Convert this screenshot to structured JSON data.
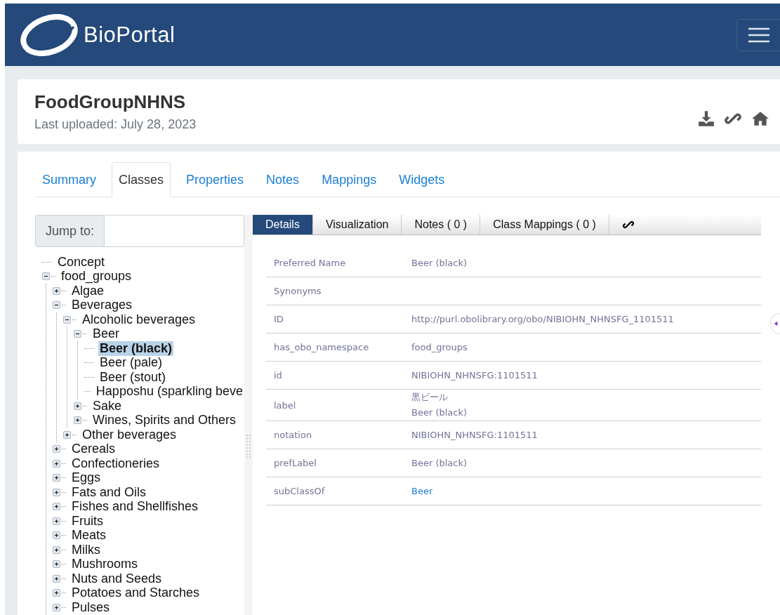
{
  "header": {
    "brand": "BioPortal"
  },
  "ontology": {
    "title": "FoodGroupNHNS",
    "subtitle": "Last uploaded: July 28, 2023"
  },
  "tabs": [
    {
      "label": "Summary",
      "selected": false
    },
    {
      "label": "Classes",
      "selected": true
    },
    {
      "label": "Properties",
      "selected": false
    },
    {
      "label": "Notes",
      "selected": false
    },
    {
      "label": "Mappings",
      "selected": false
    },
    {
      "label": "Widgets",
      "selected": false
    }
  ],
  "jump_to": {
    "label": "Jump to:"
  },
  "tree": [
    {
      "label": "Concept",
      "kind": "leaf",
      "selected": false
    },
    {
      "label": "food_groups",
      "kind": "folder",
      "expanded": true,
      "selected": false,
      "children": [
        {
          "label": "Algae",
          "kind": "folder",
          "expanded": false,
          "selected": false
        },
        {
          "label": "Beverages",
          "kind": "folder",
          "expanded": true,
          "selected": false,
          "children": [
            {
              "label": "Alcoholic beverages",
              "kind": "folder",
              "expanded": true,
              "selected": false,
              "children": [
                {
                  "label": "Beer",
                  "kind": "folder",
                  "expanded": true,
                  "selected": false,
                  "children": [
                    {
                      "label": "Beer (black)",
                      "kind": "leaf",
                      "selected": true
                    },
                    {
                      "label": "Beer (pale)",
                      "kind": "leaf",
                      "selected": false
                    },
                    {
                      "label": "Beer (stout)",
                      "kind": "leaf",
                      "selected": false
                    },
                    {
                      "label": "Happoshu (sparkling beve",
                      "kind": "leaf",
                      "selected": false
                    }
                  ]
                },
                {
                  "label": "Sake",
                  "kind": "folder",
                  "expanded": false,
                  "selected": false
                },
                {
                  "label": "Wines, Spirits and Others",
                  "kind": "folder",
                  "expanded": false,
                  "selected": false
                }
              ]
            },
            {
              "label": "Other beverages",
              "kind": "folder",
              "expanded": false,
              "selected": false
            }
          ]
        },
        {
          "label": "Cereals",
          "kind": "folder",
          "expanded": false,
          "selected": false
        },
        {
          "label": "Confectioneries",
          "kind": "folder",
          "expanded": false,
          "selected": false
        },
        {
          "label": "Eggs",
          "kind": "folder",
          "expanded": false,
          "selected": false
        },
        {
          "label": "Fats and Oils",
          "kind": "folder",
          "expanded": false,
          "selected": false
        },
        {
          "label": "Fishes and Shellfishes",
          "kind": "folder",
          "expanded": false,
          "selected": false
        },
        {
          "label": "Fruits",
          "kind": "folder",
          "expanded": false,
          "selected": false
        },
        {
          "label": "Meats",
          "kind": "folder",
          "expanded": false,
          "selected": false
        },
        {
          "label": "Milks",
          "kind": "folder",
          "expanded": false,
          "selected": false
        },
        {
          "label": "Mushrooms",
          "kind": "folder",
          "expanded": false,
          "selected": false
        },
        {
          "label": "Nuts and Seeds",
          "kind": "folder",
          "expanded": false,
          "selected": false
        },
        {
          "label": "Potatoes and Starches",
          "kind": "folder",
          "expanded": false,
          "selected": false
        },
        {
          "label": "Pulses",
          "kind": "folder",
          "expanded": false,
          "selected": false
        }
      ]
    }
  ],
  "detail_tabs": [
    {
      "label": "Details",
      "selected": true
    },
    {
      "label": "Visualization",
      "selected": false
    },
    {
      "label": "Notes ( 0 )",
      "selected": false
    },
    {
      "label": "Class Mappings ( 0 )",
      "selected": false
    }
  ],
  "details": [
    {
      "name": "Preferred Name",
      "values": [
        {
          "text": "Beer (black)",
          "kind": "text"
        }
      ]
    },
    {
      "name": "Synonyms"
    },
    {
      "name": "ID",
      "values": [
        {
          "text": "http://purl.obolibrary.org/obo/NIBIOHN_NHNSFG_1101511",
          "kind": "text"
        }
      ]
    },
    {
      "name": "has_obo_namespace",
      "values": [
        {
          "text": "food_groups",
          "kind": "text"
        }
      ]
    },
    {
      "name": "id",
      "values": [
        {
          "text": "NIBIOHN_NHNSFG:1101511",
          "kind": "text"
        }
      ]
    },
    {
      "name": "label",
      "values": [
        {
          "text": "黒ビール",
          "kind": "text"
        },
        {
          "text": "Beer (black)",
          "kind": "text"
        }
      ]
    },
    {
      "name": "notation",
      "values": [
        {
          "text": "NIBIOHN_NHNSFG:1101511",
          "kind": "text"
        }
      ]
    },
    {
      "name": "prefLabel",
      "values": [
        {
          "text": "Beer (black)",
          "kind": "text"
        }
      ]
    },
    {
      "name": "subClassOf",
      "values": [
        {
          "text": "Beer",
          "kind": "link"
        }
      ]
    }
  ]
}
